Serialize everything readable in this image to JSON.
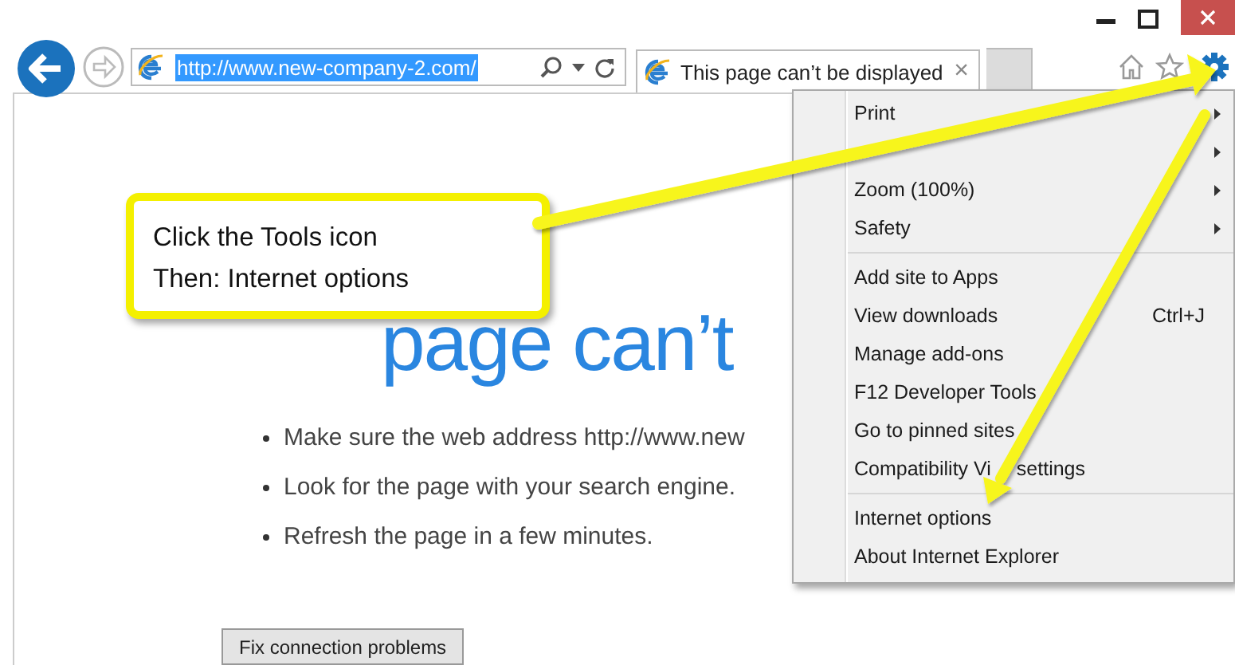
{
  "address_bar": {
    "url": "http://www.new-company-2.com/",
    "selected": true
  },
  "tab": {
    "title": "This page can’t be displayed",
    "close": "×"
  },
  "page": {
    "heading": "page can’t",
    "bullets": [
      "Make sure the web address http://www.new",
      "Look for the page with your search engine.",
      "Refresh the page in a few minutes."
    ],
    "button": "Fix connection problems"
  },
  "tools_menu": {
    "items": [
      {
        "kind": "submenu",
        "label": "Print"
      },
      {
        "kind": "submenu"
      },
      {
        "kind": "submenu",
        "label": "Zoom (100%)"
      },
      {
        "kind": "submenu",
        "label": "Safety"
      },
      {
        "kind": "separator"
      },
      {
        "kind": "item",
        "label": "Add site to Apps"
      },
      {
        "kind": "item",
        "label": "View downloads",
        "shortcut": "Ctrl+J"
      },
      {
        "kind": "item",
        "label": "Manage add-ons"
      },
      {
        "kind": "item",
        "label": "F12 Developer Tools"
      },
      {
        "kind": "item",
        "label": "Go to pinned sites"
      },
      {
        "kind": "item",
        "label": "Compatibility Vi",
        "label_after": "settings"
      },
      {
        "kind": "separator"
      },
      {
        "kind": "item",
        "label": "Internet options"
      },
      {
        "kind": "item",
        "label": "About Internet Explorer"
      }
    ]
  },
  "callout": {
    "lines": [
      "Click the Tools icon",
      "Then: Internet options"
    ]
  }
}
